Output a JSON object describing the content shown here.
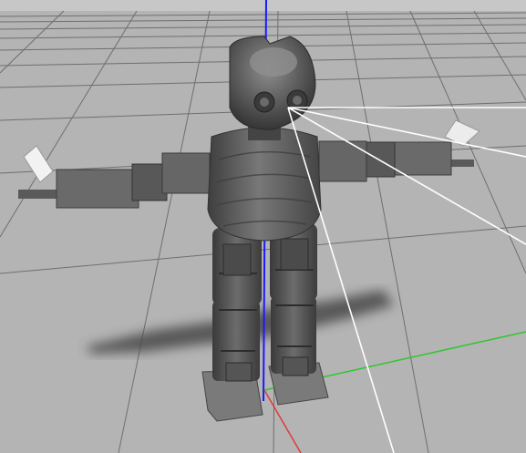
{
  "viewport": {
    "background_color": "#b9b9b9",
    "sky_color": "#c7c7c7",
    "grid_color": "#6f6f6f",
    "axis_z_color": "#1a1aff",
    "axis_x_color": "#e03a3a",
    "axis_y_color": "#2ec62e",
    "ray_color": "#ffffff",
    "robot_color": "#5e5e5e",
    "shadow_color": "#4a4a4a"
  },
  "scene": {
    "object": "humanoid-robot-model",
    "sensor": "camera-frustum-rays",
    "ray_count": 4
  }
}
